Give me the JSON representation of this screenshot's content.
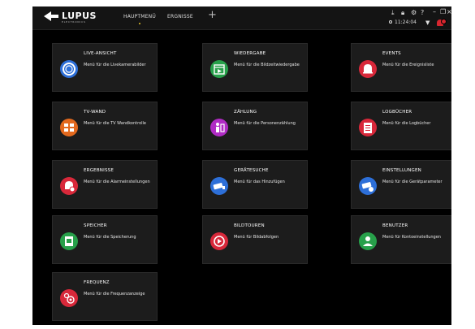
{
  "header": {
    "logo_text": "LUPUS",
    "logo_subtext": "ELECTRONICS",
    "tabs": [
      {
        "label": "HAUPTMENÜ",
        "active": true
      },
      {
        "label": "ERGNISSE",
        "active": false
      }
    ],
    "add_tab_icon": "plus-icon",
    "time": "11:24:04",
    "top_icons": [
      "person-icon",
      "lock-icon",
      "gear-icon",
      "help-icon"
    ],
    "window_buttons": [
      "minimize-icon",
      "maximize-icon",
      "close-icon"
    ],
    "status_icons": [
      "network-icon",
      "alarm-bell-icon"
    ],
    "accent_color": "#e4c12a"
  },
  "menu": {
    "tiles": [
      {
        "title": "LIVE-ANSICHT",
        "desc": "Menü für die Livekamerabilder",
        "icon": "camera-lens-icon",
        "color": "#2d6fd8"
      },
      {
        "title": "WIEDERGABE",
        "desc": "Menü für die Bildzeitwiedergabe",
        "icon": "playback-calendar-icon",
        "color": "#27a04a"
      },
      {
        "title": "EVENTS",
        "desc": "Menü für die Ereignisliste",
        "icon": "bell-icon",
        "color": "#d8283a"
      },
      {
        "title": "TV-WAND",
        "desc": "Menü für die TV Wandkontrolle",
        "icon": "tv-wall-icon",
        "color": "#e3691e"
      },
      {
        "title": "ZÄHLUNG",
        "desc": "Menü für die Personenzählung",
        "icon": "people-count-icon",
        "color": "#b02bc4"
      },
      {
        "title": "LOGBÜCHER",
        "desc": "Menü für die Logbücher",
        "icon": "clipboard-icon",
        "color": "#d8283a"
      },
      {
        "title": "ERGEBNISSE",
        "desc": "Menü für die Alarmeinstellungen",
        "icon": "alarm-settings-icon",
        "color": "#d8283a"
      },
      {
        "title": "GERÄTESUCHE",
        "desc": "Menü für das Hinzufügen",
        "icon": "device-search-icon",
        "color": "#2d6fd8"
      },
      {
        "title": "EINSTELLUNGEN",
        "desc": "Menü für die Gerätparameter",
        "icon": "camera-settings-icon",
        "color": "#2d6fd8"
      },
      {
        "title": "SPEICHER",
        "desc": "Menü für die Speicherung",
        "icon": "storage-icon",
        "color": "#27a04a"
      },
      {
        "title": "BILDTOUREN",
        "desc": "Menü für Bildabfolgen",
        "icon": "sequence-icon",
        "color": "#d8283a"
      },
      {
        "title": "BENUTZER",
        "desc": "Menü für Kontoeinstellungen",
        "icon": "user-icon",
        "color": "#27a04a"
      },
      {
        "title": "FREQUENZ",
        "desc": "Menü für die Frequenzanzeige",
        "icon": "frequency-icon",
        "color": "#d8283a"
      }
    ]
  }
}
